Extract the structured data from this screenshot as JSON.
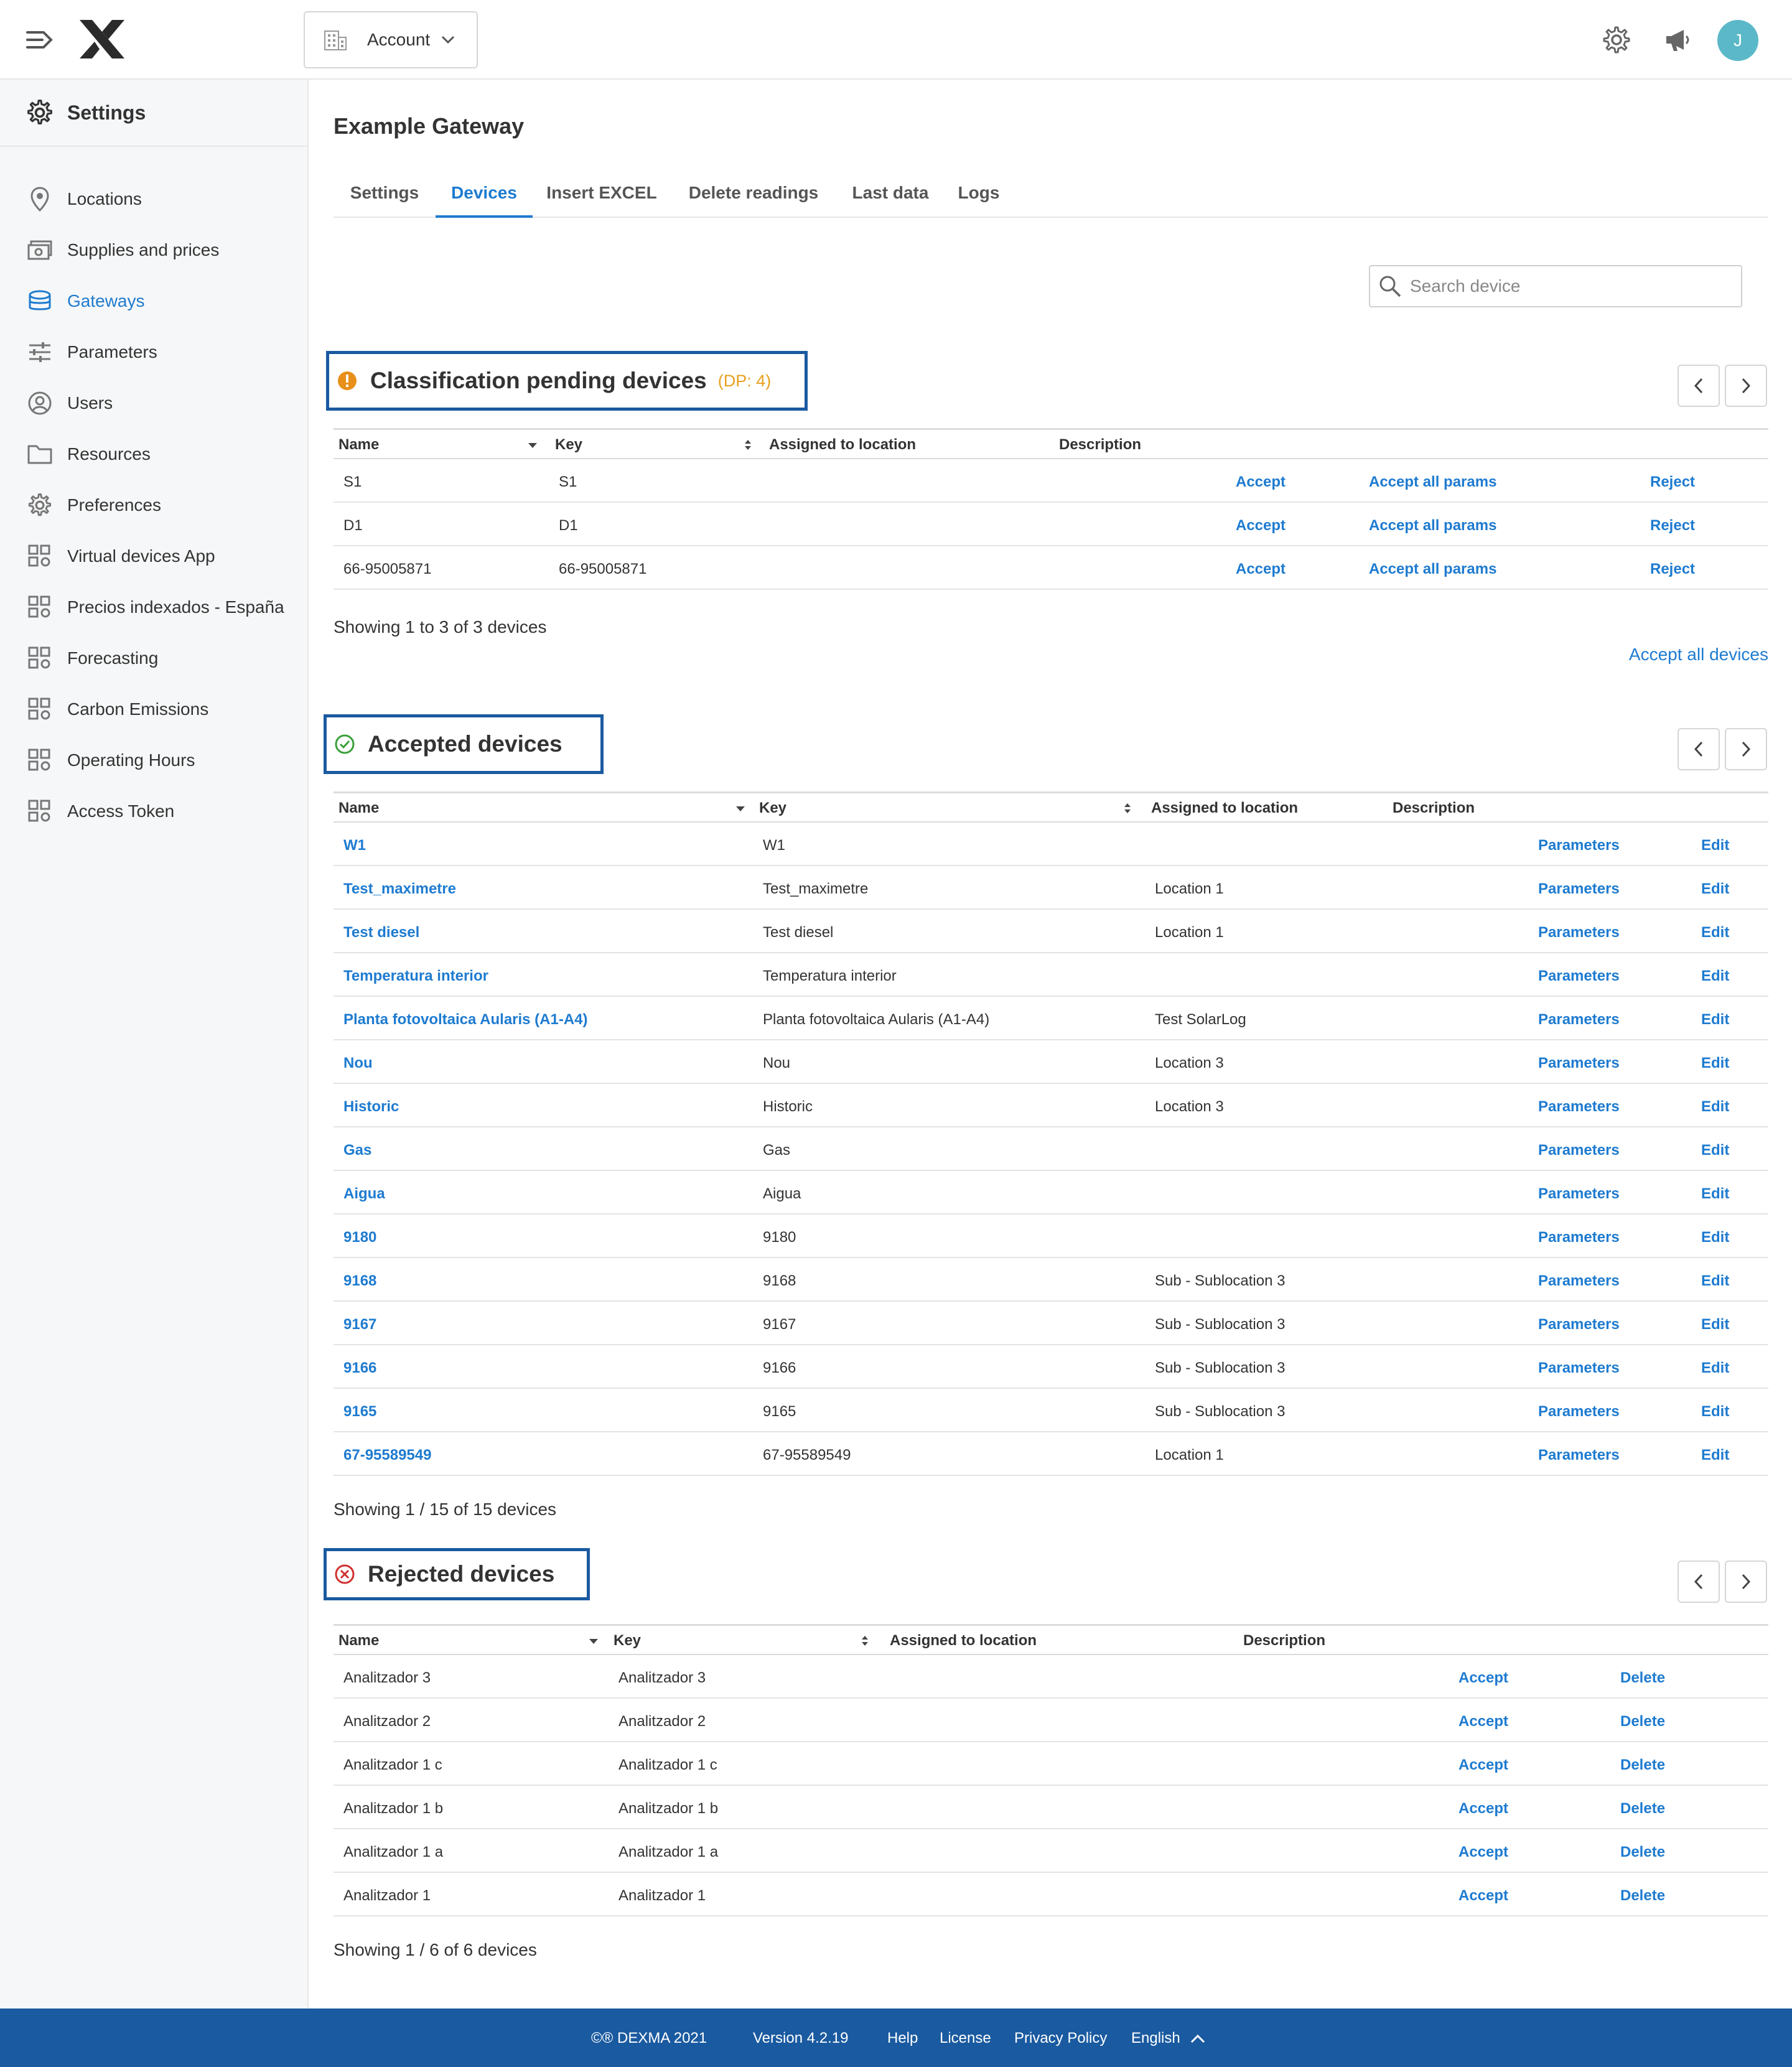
{
  "header": {
    "account_label": "Account",
    "avatar_initial": "J"
  },
  "sidebar": {
    "title": "Settings",
    "items": [
      {
        "label": "Locations",
        "icon": "location-pin-icon"
      },
      {
        "label": "Supplies and prices",
        "icon": "money-icon"
      },
      {
        "label": "Gateways",
        "icon": "gateway-icon",
        "active": true
      },
      {
        "label": "Parameters",
        "icon": "sliders-icon"
      },
      {
        "label": "Users",
        "icon": "user-circle-icon"
      },
      {
        "label": "Resources",
        "icon": "folder-icon"
      },
      {
        "label": "Preferences",
        "icon": "gear-icon"
      },
      {
        "label": "Virtual devices App",
        "icon": "app-grid-icon"
      },
      {
        "label": "Precios indexados - España",
        "icon": "app-grid-icon"
      },
      {
        "label": "Forecasting",
        "icon": "app-grid-icon"
      },
      {
        "label": "Carbon Emissions",
        "icon": "app-grid-icon"
      },
      {
        "label": "Operating Hours",
        "icon": "app-grid-icon"
      },
      {
        "label": "Access Token",
        "icon": "app-grid-icon"
      }
    ]
  },
  "page": {
    "title": "Example Gateway",
    "tabs": [
      "Settings",
      "Devices",
      "Insert EXCEL",
      "Delete readings",
      "Last data",
      "Logs"
    ],
    "active_tab": "Devices",
    "search_placeholder": "Search device"
  },
  "columns": {
    "name": "Name",
    "key": "Key",
    "location": "Assigned to location",
    "description": "Description"
  },
  "pending": {
    "title": "Classification pending devices",
    "badge": "(DP: 4)",
    "rows": [
      {
        "name": "S1",
        "key": "S1"
      },
      {
        "name": "D1",
        "key": "D1"
      },
      {
        "name": "66-95005871",
        "key": "66-95005871"
      }
    ],
    "actions": {
      "accept": "Accept",
      "accept_params": "Accept all params",
      "reject": "Reject"
    },
    "showing": "Showing 1  to  3  of  3 devices",
    "accept_all": "Accept all devices"
  },
  "accepted": {
    "title": "Accepted devices",
    "rows": [
      {
        "name": "W1",
        "key": "W1",
        "location": ""
      },
      {
        "name": "Test_maximetre",
        "key": "Test_maximetre",
        "location": "Location 1"
      },
      {
        "name": "Test diesel",
        "key": "Test diesel",
        "location": "Location 1"
      },
      {
        "name": "Temperatura interior",
        "key": "Temperatura interior",
        "location": ""
      },
      {
        "name": "Planta fotovoltaica Aularis (A1-A4)",
        "key": "Planta fotovoltaica Aularis (A1-A4)",
        "location": "Test SolarLog"
      },
      {
        "name": "Nou",
        "key": "Nou",
        "location": "Location 3"
      },
      {
        "name": "Historic",
        "key": "Historic",
        "location": "Location 3"
      },
      {
        "name": "Gas",
        "key": "Gas",
        "location": ""
      },
      {
        "name": "Aigua",
        "key": "Aigua",
        "location": ""
      },
      {
        "name": "9180",
        "key": "9180",
        "location": ""
      },
      {
        "name": "9168",
        "key": "9168",
        "location": "Sub - Sublocation 3"
      },
      {
        "name": "9167",
        "key": "9167",
        "location": "Sub - Sublocation 3"
      },
      {
        "name": "9166",
        "key": "9166",
        "location": "Sub - Sublocation 3"
      },
      {
        "name": "9165",
        "key": "9165",
        "location": "Sub - Sublocation 3"
      },
      {
        "name": "67-95589549",
        "key": "67-95589549",
        "location": "Location 1"
      }
    ],
    "actions": {
      "parameters": "Parameters",
      "edit": "Edit"
    },
    "showing": "Showing 1  /  15  of  15 devices"
  },
  "rejected": {
    "title": "Rejected devices",
    "rows": [
      {
        "name": "Analitzador 3",
        "key": "Analitzador 3"
      },
      {
        "name": "Analitzador 2",
        "key": "Analitzador 2"
      },
      {
        "name": "Analitzador 1 c",
        "key": "Analitzador 1 c"
      },
      {
        "name": "Analitzador 1 b",
        "key": "Analitzador 1 b"
      },
      {
        "name": "Analitzador 1 a",
        "key": "Analitzador 1 a"
      },
      {
        "name": "Analitzador 1",
        "key": "Analitzador 1"
      }
    ],
    "actions": {
      "accept": "Accept",
      "delete": "Delete"
    },
    "showing": "Showing 1  /  6  of  6 devices"
  },
  "footer": {
    "copyright": "©® DEXMA 2021",
    "version": "Version 4.2.19",
    "help": "Help",
    "license": "License",
    "privacy": "Privacy Policy",
    "language": "English"
  },
  "colors": {
    "accent": "#1e7bd0",
    "footer_bg": "#1a5aa0",
    "highlight_border": "#1a5aa0",
    "pending_badge": "#e8a020",
    "accepted_icon": "#3aa03a",
    "rejected_icon": "#d03030"
  }
}
